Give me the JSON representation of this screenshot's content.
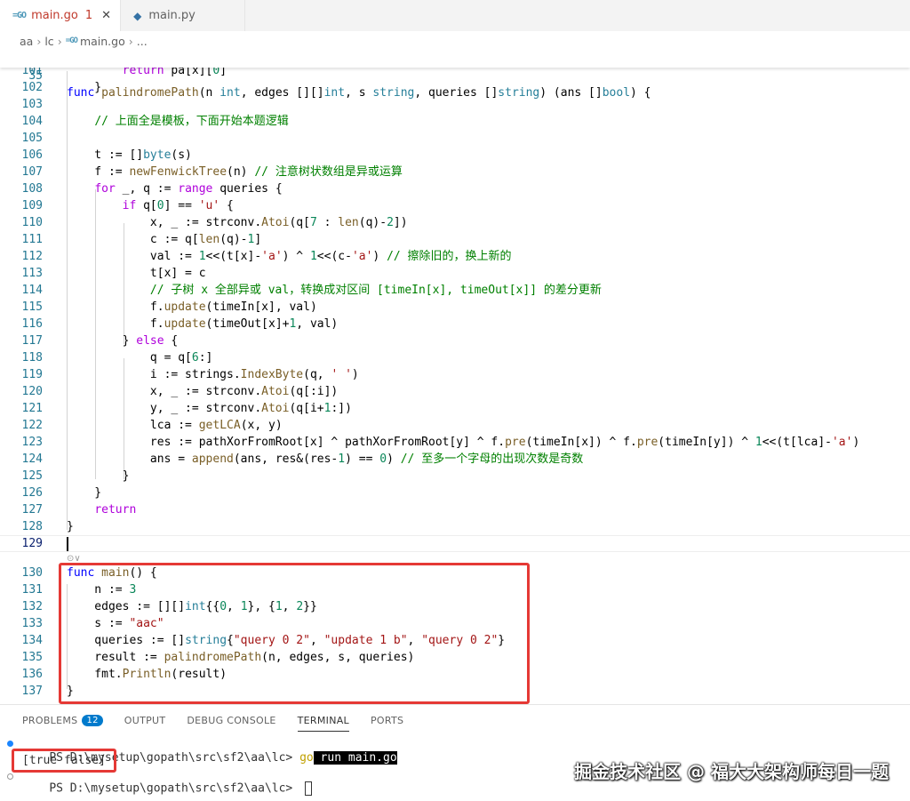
{
  "tabs": [
    {
      "label": "main.go",
      "badge": "1",
      "active": true,
      "icon": "go-file-icon"
    },
    {
      "label": "main.py",
      "active": false,
      "icon": "python-file-icon"
    }
  ],
  "breadcrumb": [
    "aa",
    "lc",
    "main.go",
    "..."
  ],
  "editor": {
    "sticky": {
      "num": "35",
      "code": "func palindromePath(n int, edges [][]int, s string, queries []string) (ans []bool) {"
    },
    "lines": [
      {
        "num": "101",
        "code": "        return pa[x][0]"
      },
      {
        "num": "102",
        "code": "    }"
      },
      {
        "num": "103",
        "code": ""
      },
      {
        "num": "104",
        "code": "    // 上面全是模板，下面开始本题逻辑"
      },
      {
        "num": "105",
        "code": ""
      },
      {
        "num": "106",
        "code": "    t := []byte(s)"
      },
      {
        "num": "107",
        "code": "    f := newFenwickTree(n) // 注意树状数组是异或运算"
      },
      {
        "num": "108",
        "code": "    for _, q := range queries {"
      },
      {
        "num": "109",
        "code": "        if q[0] == 'u' {"
      },
      {
        "num": "110",
        "code": "            x, _ := strconv.Atoi(q[7 : len(q)-2])"
      },
      {
        "num": "111",
        "code": "            c := q[len(q)-1]"
      },
      {
        "num": "112",
        "code": "            val := 1<<(t[x]-'a') ^ 1<<(c-'a') // 擦除旧的，换上新的"
      },
      {
        "num": "113",
        "code": "            t[x] = c"
      },
      {
        "num": "114",
        "code": "            // 子树 x 全部异或 val，转换成对区间 [timeIn[x], timeOut[x]] 的差分更新"
      },
      {
        "num": "115",
        "code": "            f.update(timeIn[x], val)"
      },
      {
        "num": "116",
        "code": "            f.update(timeOut[x]+1, val)"
      },
      {
        "num": "117",
        "code": "        } else {"
      },
      {
        "num": "118",
        "code": "            q = q[6:]"
      },
      {
        "num": "119",
        "code": "            i := strings.IndexByte(q, ' ')"
      },
      {
        "num": "120",
        "code": "            x, _ := strconv.Atoi(q[:i])"
      },
      {
        "num": "121",
        "code": "            y, _ := strconv.Atoi(q[i+1:])"
      },
      {
        "num": "122",
        "code": "            lca := getLCA(x, y)"
      },
      {
        "num": "123",
        "code": "            res := pathXorFromRoot[x] ^ pathXorFromRoot[y] ^ f.pre(timeIn[x]) ^ f.pre(timeIn[y]) ^ 1<<(t[lca]-'a')"
      },
      {
        "num": "124",
        "code": "            ans = append(ans, res&(res-1) == 0) // 至多一个字母的出现次数是奇数"
      },
      {
        "num": "125",
        "code": "        }"
      },
      {
        "num": "126",
        "code": "    }"
      },
      {
        "num": "127",
        "code": "    return"
      },
      {
        "num": "128",
        "code": "}"
      },
      {
        "num": "129",
        "code": ""
      },
      {
        "num": "130",
        "code": "func main() {"
      },
      {
        "num": "131",
        "code": "    n := 3"
      },
      {
        "num": "132",
        "code": "    edges := [][]int{{0, 1}, {1, 2}}"
      },
      {
        "num": "133",
        "code": "    s := \"aac\""
      },
      {
        "num": "134",
        "code": "    queries := []string{\"query 0 2\", \"update 1 b\", \"query 0 2\"}"
      },
      {
        "num": "135",
        "code": "    result := palindromePath(n, edges, s, queries)"
      },
      {
        "num": "136",
        "code": "    fmt.Println(result)"
      },
      {
        "num": "137",
        "code": "}"
      }
    ]
  },
  "panel": {
    "tabs": [
      {
        "label": "PROBLEMS",
        "badge": "12"
      },
      {
        "label": "OUTPUT"
      },
      {
        "label": "DEBUG CONSOLE"
      },
      {
        "label": "TERMINAL",
        "active": true
      },
      {
        "label": "PORTS"
      }
    ],
    "terminal": {
      "prompt1": "PS D:\\mysetup\\gopath\\src\\sf2\\aa\\lc> ",
      "cmd_go": "go",
      "cmd_rest": " run main.go",
      "output": "[true false]",
      "prompt2": "PS D:\\mysetup\\gopath\\src\\sf2\\aa\\lc> "
    }
  },
  "watermark": "掘金技术社区 @ 福大大架构师每日一题",
  "colors": {
    "keyword": "#0000ff",
    "control": "#af00db",
    "type": "#267f99",
    "function": "#795e26",
    "string": "#a31515",
    "number": "#098658",
    "comment": "#008000",
    "highlight": "#e53935",
    "badge": "#007acc"
  }
}
